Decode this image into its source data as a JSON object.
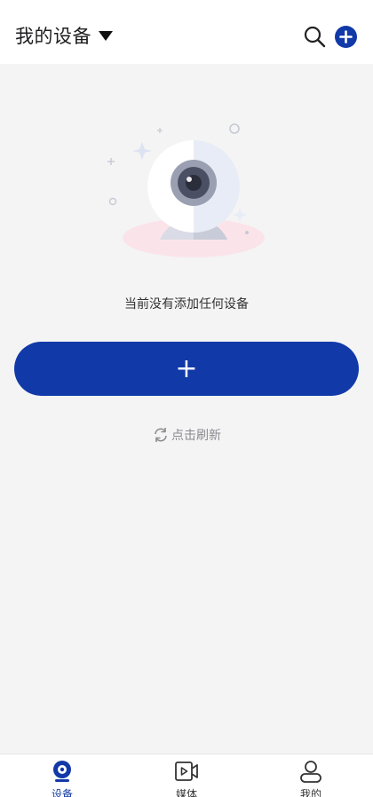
{
  "header": {
    "title": "我的设备",
    "caret_icon": "caret-down-icon",
    "search_icon": "search-icon",
    "add_icon": "plus-circle-icon"
  },
  "main": {
    "illustration": "webcam-illustration",
    "empty_message": "当前没有添加任何设备",
    "add_button_label": "+",
    "refresh_icon": "refresh-icon",
    "refresh_label": "点击刷新"
  },
  "bottom_nav": {
    "items": [
      {
        "label": "设备",
        "icon": "camera-icon",
        "active": true
      },
      {
        "label": "媒体",
        "icon": "video-icon",
        "active": false
      },
      {
        "label": "我的",
        "icon": "user-icon",
        "active": false
      }
    ]
  },
  "colors": {
    "accent": "#1139a8",
    "background": "#f4f4f5"
  }
}
